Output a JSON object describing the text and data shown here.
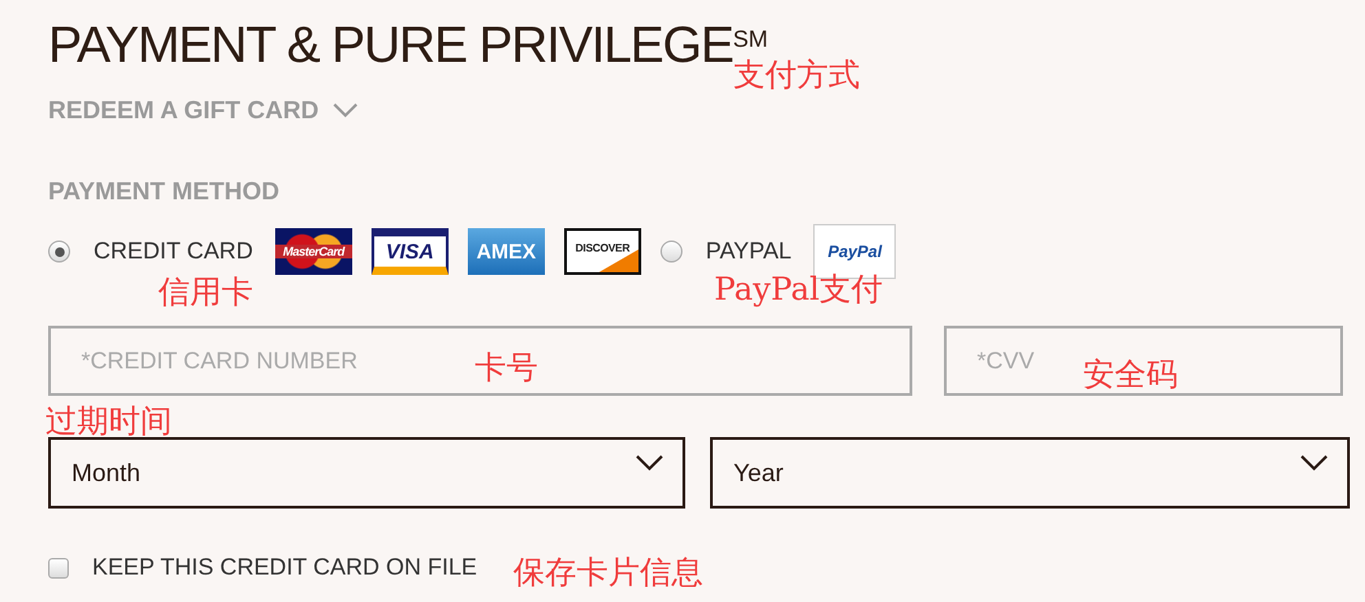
{
  "title": "PAYMENT & PURE PRIVILEGE$^{SM}$",
  "gift_card": {
    "label": "REDEEM A GIFT CARD",
    "expanded": false
  },
  "payment_method": {
    "label": "PAYMENT METHOD",
    "options": [
      {
        "label": "CREDIT CARD",
        "selected": true,
        "logos": [
          {
            "kind": "mastercard",
            "label": "MasterCard"
          },
          {
            "kind": "visa",
            "label": "VISA"
          },
          {
            "kind": "amex",
            "label": "AMEX"
          },
          {
            "kind": "discover",
            "label": "DISCOVER"
          }
        ]
      },
      {
        "label": "PAYPAL",
        "selected": false,
        "logos": [
          {
            "kind": "paypal",
            "label": "PayPal"
          }
        ]
      }
    ]
  },
  "card_number": {
    "placeholder": "*CREDIT CARD NUMBER"
  },
  "cvv": {
    "placeholder": "*CVV"
  },
  "expiry": [
    {
      "value": "Month"
    },
    {
      "value": "Year"
    }
  ],
  "keep_on_file": {
    "label": "KEEP THIS CREDIT CARD ON FILE",
    "checked": false
  },
  "annotations": [
    "支付方式",
    "信用卡",
    "PayPal支付",
    "卡号",
    "安全码",
    "过期时间",
    "保存卡片信息"
  ]
}
